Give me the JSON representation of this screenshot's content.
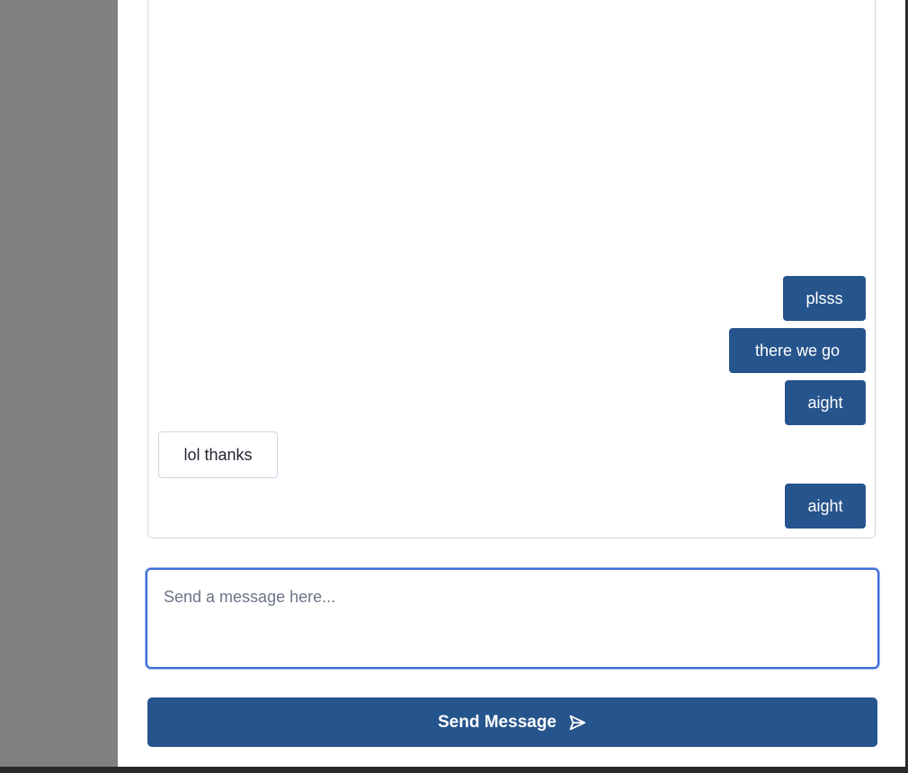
{
  "messages": [
    {
      "text": "plsss",
      "sender": "me"
    },
    {
      "text": "there we go",
      "sender": "me"
    },
    {
      "text": "aight",
      "sender": "me"
    },
    {
      "text": "lol thanks",
      "sender": "other"
    },
    {
      "text": "aight",
      "sender": "me"
    }
  ],
  "composer": {
    "placeholder": "Send a message here...",
    "value": ""
  },
  "send_button": {
    "label": "Send Message",
    "icon": "send-arrow-icon"
  },
  "colors": {
    "accent": "#26548c",
    "focus_ring": "#3b6fd9",
    "left_background": "#808080",
    "border": "#cfd6e4"
  }
}
